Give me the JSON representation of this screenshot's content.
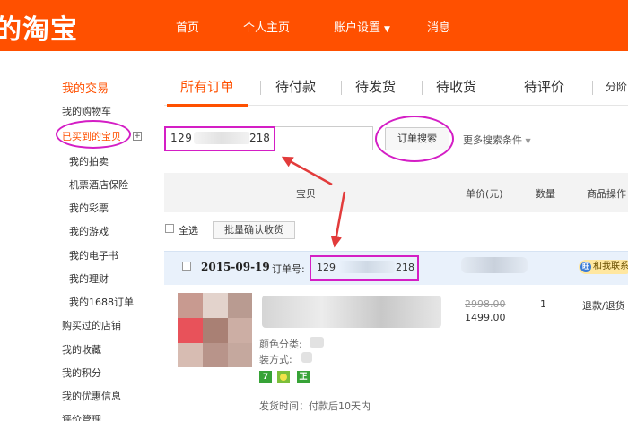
{
  "header": {
    "logo": "的淘宝",
    "nav": [
      "首页",
      "个人主页",
      "账户设置",
      "消息"
    ]
  },
  "sidebar": {
    "title": "我的交易",
    "items": [
      "我的购物车",
      "已买到的宝贝",
      "我的拍卖",
      "机票酒店保险",
      "我的彩票",
      "我的游戏",
      "我的电子书",
      "我的理财",
      "我的1688订单",
      "购买过的店铺",
      "我的收藏",
      "我的积分",
      "我的优惠信息",
      "评价管理"
    ],
    "expand_symbol": "+"
  },
  "tabs": [
    "所有订单",
    "待付款",
    "待发货",
    "待收货",
    "待评价",
    "分阶"
  ],
  "search": {
    "value_prefix": "129",
    "value_suffix": "218",
    "button": "订单搜索",
    "more": "更多搜索条件"
  },
  "table": {
    "headers": [
      "宝贝",
      "单价(元)",
      "数量",
      "商品操作"
    ],
    "select_all": "全选",
    "batch_button": "批量确认收货"
  },
  "order": {
    "date": "2015-09-19",
    "number_label": "订单号:",
    "number_prefix": "129",
    "number_suffix": "218",
    "badge": "和我联系",
    "badge_icon": "旺",
    "item": {
      "attr_color_label": "颜色分类:",
      "attr_install_label": "装方式:",
      "tags": [
        {
          "text": "7",
          "color": "#37a337"
        },
        {
          "text": "",
          "color": "#7cbf3a"
        },
        {
          "text": "正",
          "color": "#37a337"
        }
      ],
      "ship": "发货时间：付款后10天内",
      "price_old": "2998.00",
      "price_new": "1499.00",
      "qty": "1",
      "action": "退款/退货"
    }
  },
  "colors": {
    "brand": "#ff5000",
    "highlight": "#d41ec5",
    "arrow": "#e23b3b"
  }
}
